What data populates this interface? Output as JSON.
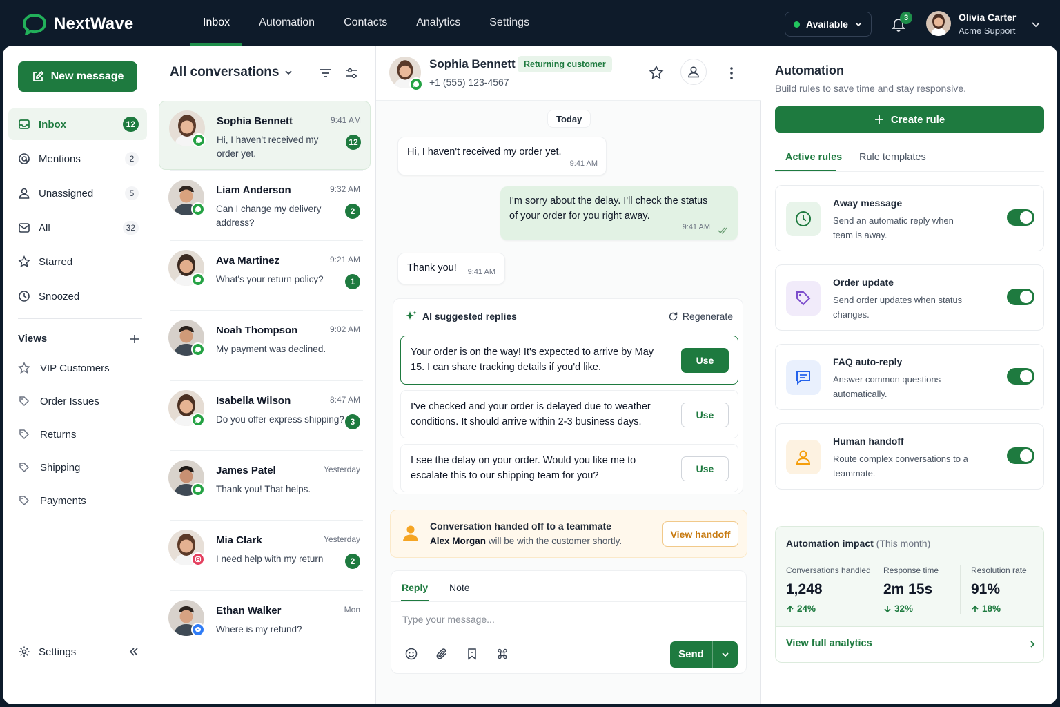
{
  "brand": {
    "name": "NextWave",
    "accent": "#1e7a3f"
  },
  "topnav": [
    {
      "label": "Inbox",
      "active": true
    },
    {
      "label": "Automation",
      "active": false
    },
    {
      "label": "Contacts",
      "active": false
    },
    {
      "label": "Analytics",
      "active": false
    },
    {
      "label": "Settings",
      "active": false
    }
  ],
  "status": {
    "label": "Available"
  },
  "notifications": {
    "count": "3"
  },
  "user": {
    "name": "Olivia Carter",
    "org": "Acme Support"
  },
  "sidebar": {
    "new_message_label": "New message",
    "items": [
      {
        "label": "Inbox",
        "count": "12",
        "icon": "inbox-icon"
      },
      {
        "label": "Mentions",
        "count": "2",
        "icon": "at-icon"
      },
      {
        "label": "Unassigned",
        "count": "5",
        "icon": "user-icon"
      },
      {
        "label": "All",
        "count": "32",
        "icon": "mail-icon"
      },
      {
        "label": "Starred",
        "count": "",
        "icon": "star-icon"
      },
      {
        "label": "Snoozed",
        "count": "",
        "icon": "clock-icon"
      }
    ],
    "views_label": "Views",
    "views": [
      "VIP Customers",
      "Order Issues",
      "Returns",
      "Shipping",
      "Payments"
    ],
    "settings_label": "Settings"
  },
  "conversations": {
    "title": "All conversations",
    "items": [
      {
        "name": "Sophia Bennett",
        "time": "9:41 AM",
        "preview": "Hi, I haven't received my order yet.",
        "unread": "12",
        "channel": "whatsapp"
      },
      {
        "name": "Liam Anderson",
        "time": "9:32 AM",
        "preview": "Can I change my delivery address?",
        "unread": "2",
        "channel": "whatsapp"
      },
      {
        "name": "Ava Martinez",
        "time": "9:21 AM",
        "preview": "What's your return policy?",
        "unread": "1",
        "channel": "whatsapp"
      },
      {
        "name": "Noah Thompson",
        "time": "9:02 AM",
        "preview": "My payment was declined.",
        "unread": "",
        "channel": "whatsapp"
      },
      {
        "name": "Isabella Wilson",
        "time": "8:47 AM",
        "preview": "Do you offer express shipping?",
        "unread": "3",
        "channel": "whatsapp"
      },
      {
        "name": "James Patel",
        "time": "Yesterday",
        "preview": "Thank you! That helps.",
        "unread": "",
        "channel": "whatsapp"
      },
      {
        "name": "Mia Clark",
        "time": "Yesterday",
        "preview": "I need help with my return",
        "unread": "2",
        "channel": "instagram"
      },
      {
        "name": "Ethan Walker",
        "time": "Mon",
        "preview": "Where is my refund?",
        "unread": "",
        "channel": "messenger"
      }
    ]
  },
  "chat": {
    "contact_name": "Sophia Bennett",
    "tag": "Returning customer",
    "phone": "+1 (555) 123-4567",
    "date_divider": "Today",
    "messages": [
      {
        "dir": "in",
        "text": "Hi, I haven't received my order yet.",
        "time": "9:41 AM"
      },
      {
        "dir": "out",
        "text": "I'm sorry about the delay. I'll check the status of your order for you right away.",
        "time": "9:41 AM"
      },
      {
        "dir": "in",
        "text": "Thank you!",
        "time": "9:41 AM"
      }
    ],
    "ai": {
      "title": "AI suggested replies",
      "regenerate": "Regenerate",
      "use_label": "Use",
      "suggestions": [
        "Your order is on the way! It's expected to arrive by May 15. I can share tracking details if you'd like.",
        "I've checked and your order is delayed due to weather conditions. It should arrive within 2-3 business days.",
        "I see the delay on your order. Would you like me to escalate this to our shipping team for you?"
      ]
    },
    "handoff": {
      "title": "Conversation handed off to a teammate",
      "agent": "Alex Morgan",
      "rest": " will be with the customer shortly.",
      "button": "View handoff"
    },
    "composer": {
      "tabs": [
        "Reply",
        "Note"
      ],
      "placeholder": "Type your message...",
      "send_label": "Send"
    }
  },
  "automation": {
    "title": "Automation",
    "subtitle": "Build rules to save time and stay responsive.",
    "create_label": "Create rule",
    "tabs": [
      "Active rules",
      "Rule templates"
    ],
    "rules": [
      {
        "title": "Away message",
        "desc": "Send an automatic reply when team is away.",
        "icon": "clock-icon",
        "color": "#1e7a3f",
        "enabled": true
      },
      {
        "title": "Order update",
        "desc": "Send order updates when status changes.",
        "icon": "tag-icon",
        "color": "#7c4dcc",
        "enabled": true
      },
      {
        "title": "FAQ auto-reply",
        "desc": "Answer common questions automatically.",
        "icon": "chat-icon",
        "color": "#2563eb",
        "enabled": true
      },
      {
        "title": "Human handoff",
        "desc": "Route complex conversations to a teammate.",
        "icon": "person-icon",
        "color": "#f59e0b",
        "enabled": true
      }
    ],
    "impact": {
      "title": "Automation impact",
      "period": "(This month)",
      "metrics": [
        {
          "label": "Conversations handled",
          "value": "1,248",
          "delta": "24%",
          "dir": "up"
        },
        {
          "label": "Response time",
          "value": "2m 15s",
          "delta": "32%",
          "dir": "down"
        },
        {
          "label": "Resolution rate",
          "value": "91%",
          "delta": "18%",
          "dir": "up"
        }
      ],
      "link": "View full analytics"
    }
  }
}
